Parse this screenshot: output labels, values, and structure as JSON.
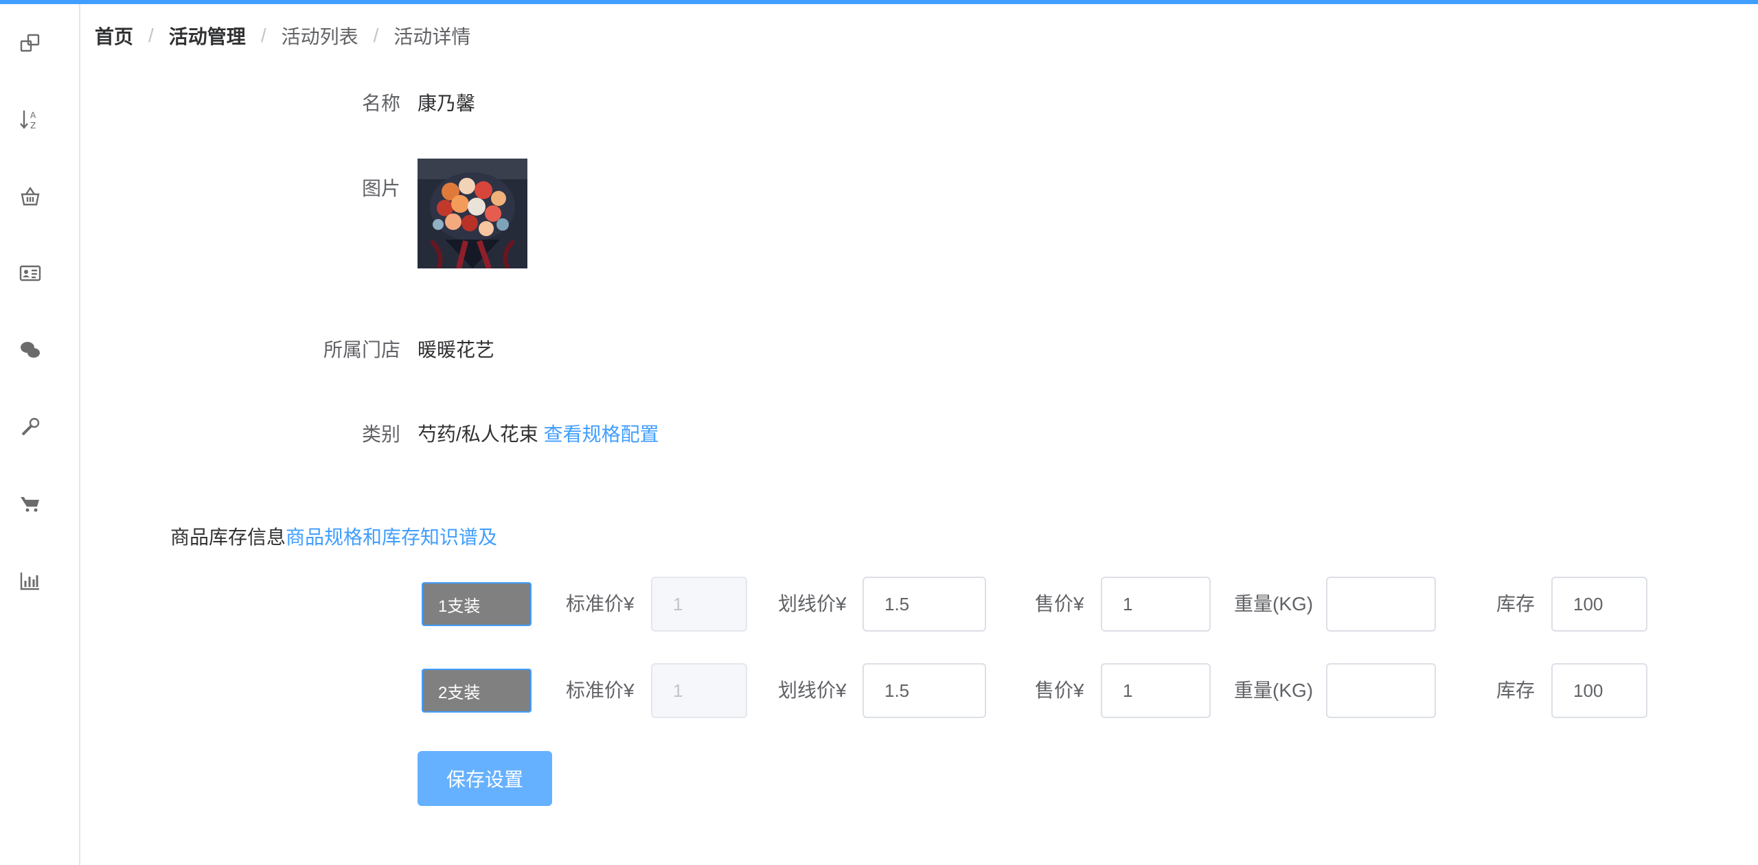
{
  "breadcrumb": {
    "home": "首页",
    "activity_mgmt": "活动管理",
    "activity_list": "活动列表",
    "activity_detail": "活动详情",
    "separator": "/"
  },
  "sidebar": {
    "icons": [
      "windows-icon",
      "sort-az-icon",
      "basket-icon",
      "id-card-icon",
      "wechat-icon",
      "wrench-icon",
      "cart-icon",
      "bar-chart-icon"
    ]
  },
  "detail": {
    "name_label": "名称",
    "name_value": "康乃馨",
    "image_label": "图片",
    "store_label": "所属门店",
    "store_value": "暖暖花艺",
    "category_label": "类别",
    "category_value": "芍药/私人花束",
    "spec_link": "查看规格配置"
  },
  "inventory": {
    "title": "商品库存信息",
    "knowledge_link": "商品规格和库存知识谱及",
    "labels": {
      "standard_price": "标准价¥",
      "strike_price": "划线价¥",
      "sale_price": "售价¥",
      "weight": "重量(KG)",
      "stock": "库存"
    },
    "rows": [
      {
        "spec": "1支装",
        "standard_price": "1",
        "strike_price": "1.5",
        "sale_price": "1",
        "weight": "",
        "stock": "100"
      },
      {
        "spec": "2支装",
        "standard_price": "1",
        "strike_price": "1.5",
        "sale_price": "1",
        "weight": "",
        "stock": "100"
      }
    ]
  },
  "actions": {
    "save_label": "保存设置"
  },
  "colors": {
    "accent": "#409eff",
    "button": "#66b1ff",
    "tag_bg": "#808080"
  }
}
